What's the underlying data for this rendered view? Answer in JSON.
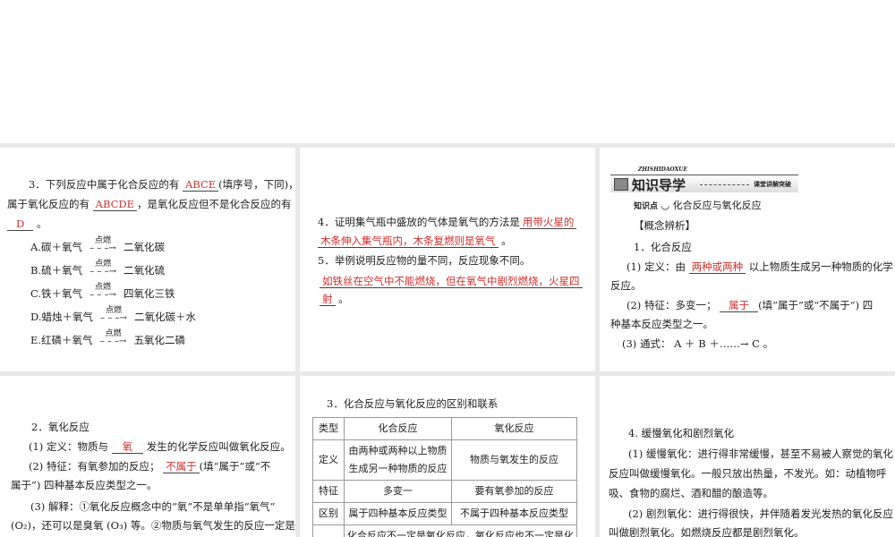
{
  "p1": {
    "q": "3．下列反应中属于化合反应的有",
    "a1": "ABCE",
    "mid1": "(填序号，下同)，",
    "l2a": "属于氧化反应的有",
    "a2": "ABCDE",
    "l2b": "，是氧化反应但不是化合反应的有",
    "a3": "D",
    "end": "。",
    "cond": "点燃",
    "items": [
      {
        "lhs": "A.碳＋氧气",
        "rhs": "二氧化碳"
      },
      {
        "lhs": "B.硫＋氧气",
        "rhs": "二氧化硫"
      },
      {
        "lhs": "C.铁＋氧气",
        "rhs": "四氧化三铁"
      },
      {
        "lhs": "D.蜡烛＋氧气",
        "rhs": "二氧化碳＋水"
      },
      {
        "lhs": "E.红磷＋氧气",
        "rhs": "五氧化二磷"
      }
    ]
  },
  "p2": {
    "q4": "4．证明集气瓶中盛放的气体是氧气的方法是",
    "a4a": "用带火星的",
    "a4b": "木条伸入集气瓶内，木条复燃则是氧气",
    "end": "。",
    "q5": "5．举例说明反应物的量不同，反应现象不同。",
    "a5a": "如铁丝在空气中不能燃烧，但在氧气中剧烈燃烧，火星四",
    "a5b": "射"
  },
  "p3": {
    "banner_pinyin": "ZHISHIDAOXUE",
    "banner": "知识导学",
    "banner_tag": "课堂讲解突破",
    "kp_label": "知识点",
    "kp": "化合反应与氧化反应",
    "concept": "【概念辨析】",
    "h1": "1．化合反应",
    "d1a": "(1) 定义：由",
    "d1ans": "两种或两种",
    "d1b": "以上物质生成另一种物质的化学",
    "d1c": "反应。",
    "f1a": "(2) 特征：多变一；",
    "f1ans": "属于",
    "f1b": "(填“属于”或“不属于”) 四",
    "f1c": "种基本反应类型之一。",
    "g1": "(3) 通式： A ＋ B ＋……→ C 。"
  },
  "p4": {
    "h": "2．氧化反应",
    "d1": "(1) 定义：物质与",
    "dans": "氧",
    "d2": "发生的化学反应叫做氧化反应。",
    "f1": "(2) 特征：有氧参加的反应；",
    "fans": "不属于",
    "f2": "(填“属于”或“不",
    "f3": "属于”) 四种基本反应类型之一。",
    "e1": "(3) 解释：①氧化反应概念中的“氧”不是单单指“氧气”",
    "e2": "(O₂)，还可以是臭氧 (O₃) 等。②物质与氧气发生的反应一定是"
  },
  "p5": {
    "title": "3．化合反应与氧化反应的区别和联系",
    "rows": [
      [
        "类型",
        "化合反应",
        "氧化反应"
      ],
      [
        "定义",
        "由两种或两种以上物质生成另一种物质的反应",
        "物质与氧发生的反应"
      ],
      [
        "特征",
        "多变一",
        "要有氧参加的反应"
      ],
      [
        "区别",
        "属于四种基本反应类型",
        "不属于四种基本反应类型"
      ]
    ],
    "last": "化合反应不一定是氧化反应，氧化反应也不一定是化"
  },
  "p6": {
    "h": "4. 缓慢氧化和剧烈氧化",
    "s1": "(1) 缓慢氧化：进行得非常缓慢，甚至不易被人察觉的氧化",
    "s2": "反应叫做缓慢氧化。一般只放出热量，不发光。如：动植物呼",
    "s3": "吸、食物的腐烂、酒和醋的酿造等。",
    "v1": "(2) 剧烈氧化：进行得很快，并伴随着发光发热的氧化反应",
    "v2": "叫做剧烈氧化。如燃烧反应都是剧烈氧化。"
  }
}
